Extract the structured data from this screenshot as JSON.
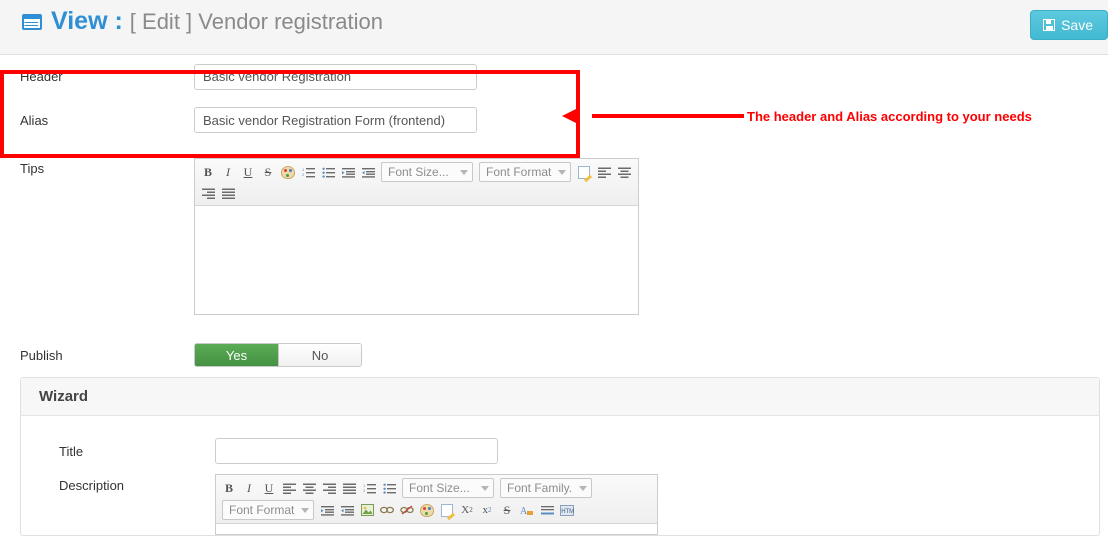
{
  "header": {
    "icon": "list-view-icon",
    "view_label": "View :",
    "subtitle": "[ Edit ] Vendor registration",
    "save_label": "Save",
    "save_icon": "floppy-disk-icon",
    "accent_color": "#2f8fd4",
    "save_color": "#4cc0d8"
  },
  "form": {
    "header_field": {
      "label": "Header",
      "value": "Basic vendor Registration",
      "placeholder": ""
    },
    "alias_field": {
      "label": "Alias",
      "value": "Basic vendor Registration Form (frontend)",
      "placeholder": ""
    },
    "tips_field": {
      "label": "Tips",
      "value": ""
    },
    "publish_field": {
      "label": "Publish",
      "yes_label": "Yes",
      "no_label": "No",
      "selected": "Yes",
      "on_color": "#4f9e4f"
    }
  },
  "tips_editor": {
    "font_size_label": "Font Size...",
    "font_format_label": "Font Format",
    "buttons_row1": [
      {
        "name": "bold-icon",
        "glyph": "B"
      },
      {
        "name": "italic-icon",
        "glyph": "I"
      },
      {
        "name": "underline-icon",
        "glyph": "U"
      },
      {
        "name": "strikethrough-icon",
        "glyph": "S"
      }
    ]
  },
  "wizard": {
    "title": "Wizard",
    "title_field": {
      "label": "Title",
      "value": "",
      "placeholder": ""
    },
    "description_field": {
      "label": "Description",
      "value": ""
    },
    "description_editor": {
      "font_size_label": "Font Size...",
      "font_family_label": "Font Family.",
      "font_format_label": "Font Format"
    }
  },
  "annotation": {
    "text": "The header and Alias according to your needs",
    "color": "#fe0000"
  }
}
